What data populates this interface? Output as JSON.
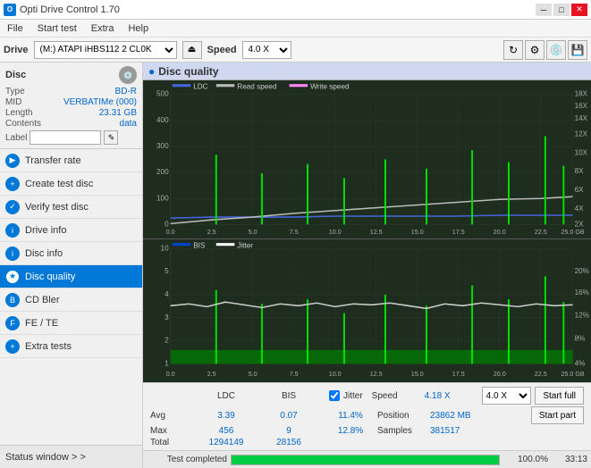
{
  "titleBar": {
    "title": "Opti Drive Control 1.70",
    "minBtn": "─",
    "maxBtn": "□",
    "closeBtn": "✕"
  },
  "menuBar": {
    "items": [
      "File",
      "Start test",
      "Extra",
      "Help"
    ]
  },
  "driveBar": {
    "label": "Drive",
    "driveValue": "(M:) ATAPI iHBS112  2 CL0K",
    "speedLabel": "Speed",
    "speedValue": "4.0 X"
  },
  "disc": {
    "title": "Disc",
    "type": {
      "key": "Type",
      "val": "BD-R"
    },
    "mid": {
      "key": "MID",
      "val": "VERBATIMe (000)"
    },
    "length": {
      "key": "Length",
      "val": "23.31 GB"
    },
    "contents": {
      "key": "Contents",
      "val": "data"
    },
    "labelKey": "Label"
  },
  "nav": {
    "items": [
      {
        "label": "Transfer rate",
        "id": "transfer-rate"
      },
      {
        "label": "Create test disc",
        "id": "create-test-disc"
      },
      {
        "label": "Verify test disc",
        "id": "verify-test-disc"
      },
      {
        "label": "Drive info",
        "id": "drive-info"
      },
      {
        "label": "Disc info",
        "id": "disc-info"
      },
      {
        "label": "Disc quality",
        "id": "disc-quality",
        "active": true
      },
      {
        "label": "CD Bler",
        "id": "cd-bler"
      },
      {
        "label": "FE / TE",
        "id": "fe-te"
      },
      {
        "label": "Extra tests",
        "id": "extra-tests"
      }
    ],
    "statusWindow": "Status window > >"
  },
  "qualityHeader": {
    "title": "Disc quality"
  },
  "legendTop": {
    "ldc": "LDC",
    "readSpeed": "Read speed",
    "writeSpeed": "Write speed"
  },
  "legendBottom": {
    "bis": "BIS",
    "jitter": "Jitter"
  },
  "chartTop": {
    "yLeft": [
      "500",
      "400",
      "300",
      "200",
      "100",
      "0"
    ],
    "yRight": [
      "18X",
      "16X",
      "14X",
      "12X",
      "10X",
      "8X",
      "6X",
      "4X",
      "2X"
    ],
    "xLabels": [
      "0.0",
      "2.5",
      "5.0",
      "7.5",
      "10.0",
      "12.5",
      "15.0",
      "17.5",
      "20.0",
      "22.5",
      "25.0 GB"
    ]
  },
  "chartBottom": {
    "yLeft": [
      "10",
      "9",
      "8",
      "7",
      "6",
      "5",
      "4",
      "3",
      "2",
      "1"
    ],
    "yRight": [
      "20%",
      "16%",
      "12%",
      "8%",
      "4%"
    ],
    "xLabels": [
      "0.0",
      "2.5",
      "5.0",
      "7.5",
      "10.0",
      "12.5",
      "15.0",
      "17.5",
      "20.0",
      "22.5",
      "25.0 GB"
    ]
  },
  "stats": {
    "headers": [
      "LDC",
      "BIS"
    ],
    "jitterHeader": "Jitter",
    "rows": [
      {
        "label": "Avg",
        "ldc": "3.39",
        "bis": "0.07",
        "jitter": "11.4%"
      },
      {
        "label": "Max",
        "ldc": "456",
        "bis": "9",
        "jitter": "12.8%"
      },
      {
        "label": "Total",
        "ldc": "1294149",
        "bis": "28156",
        "jitter": ""
      }
    ],
    "speed": {
      "label": "Speed",
      "value": "4.18 X",
      "dropdown": "4.0 X"
    },
    "position": {
      "label": "Position",
      "value": "23862 MB"
    },
    "samples": {
      "label": "Samples",
      "value": "381517"
    },
    "buttons": {
      "startFull": "Start full",
      "startPart": "Start part"
    }
  },
  "progressBar": {
    "percent": "100.0%",
    "fill": 100,
    "time": "33:13",
    "statusText": "Test completed"
  }
}
